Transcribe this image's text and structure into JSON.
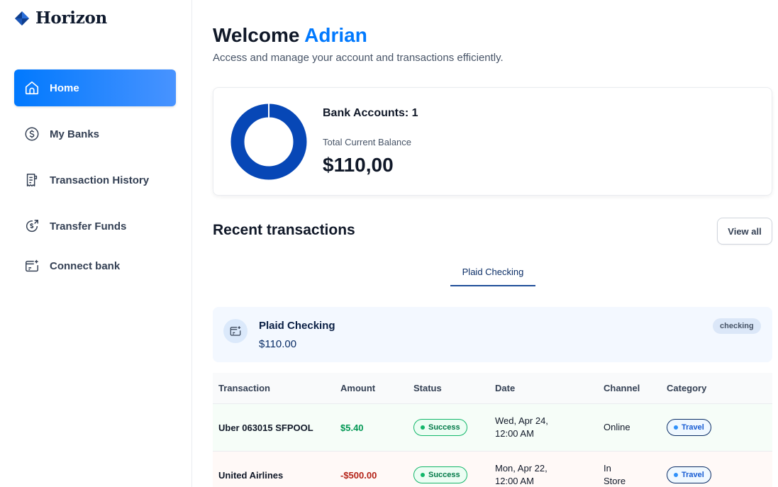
{
  "app": {
    "name": "Horizon",
    "brand_color": "#0179fe"
  },
  "sidebar": {
    "items": [
      {
        "label": "Home",
        "icon": "home-icon",
        "active": true
      },
      {
        "label": "My Banks",
        "icon": "dollar-circle-icon",
        "active": false
      },
      {
        "label": "Transaction History",
        "icon": "receipt-icon",
        "active": false
      },
      {
        "label": "Transfer Funds",
        "icon": "money-send-icon",
        "active": false
      },
      {
        "label": "Connect bank",
        "icon": "connect-bank-icon",
        "active": false
      }
    ]
  },
  "header": {
    "greeting": "Welcome",
    "user_name": "Adrian",
    "subtitle": "Access and manage your account and transactions efficiently."
  },
  "balance": {
    "accounts_label": "Bank Accounts: 1",
    "total_label": "Total Current Balance",
    "total_value": "$110,00",
    "chart_color": "#0747b6"
  },
  "recent": {
    "title": "Recent transactions",
    "view_all_label": "View all",
    "tabs": [
      {
        "label": "Plaid Checking",
        "active": true
      }
    ]
  },
  "bank_card": {
    "name": "Plaid Checking",
    "amount": "$110.00",
    "type": "checking"
  },
  "table": {
    "columns": [
      "Transaction",
      "Amount",
      "Status",
      "Date",
      "Channel",
      "Category"
    ],
    "rows": [
      {
        "name": "Uber 063015 SFPOOL",
        "amount": "$5.40",
        "kind": "credit",
        "status": "Success",
        "date_line1": "Wed, Apr 24,",
        "date_line2": "12:00 AM",
        "channel_line1": "Online",
        "channel_line2": "",
        "category": "Travel"
      },
      {
        "name": "United Airlines",
        "amount": "-$500.00",
        "kind": "debit",
        "status": "Success",
        "date_line1": "Mon, Apr 22,",
        "date_line2": "12:00 AM",
        "channel_line1": "In",
        "channel_line2": "Store",
        "category": "Travel"
      }
    ]
  }
}
